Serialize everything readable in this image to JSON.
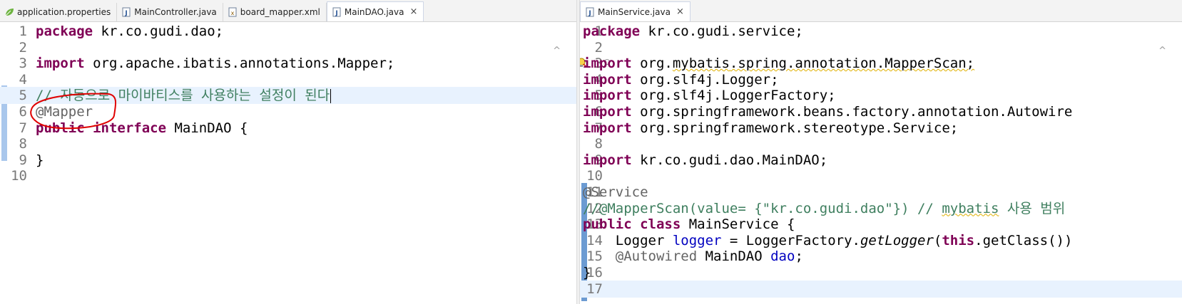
{
  "left_pane": {
    "tabs": [
      {
        "label": "application.properties",
        "icon": "leaf-icon",
        "active": false
      },
      {
        "label": "MainController.java",
        "icon": "java-file-icon",
        "active": false
      },
      {
        "label": "board_mapper.xml",
        "icon": "xml-file-icon",
        "active": false
      },
      {
        "label": "MainDAO.java",
        "icon": "java-file-icon",
        "active": true,
        "close": "×"
      }
    ],
    "lines": [
      {
        "n": "1",
        "code": [
          {
            "t": "package",
            "c": "kw"
          },
          {
            "t": " kr.co.gudi.dao;"
          }
        ]
      },
      {
        "n": "2",
        "code": []
      },
      {
        "n": "3",
        "code": [
          {
            "t": "import",
            "c": "kw"
          },
          {
            "t": " org.apache.ibatis.annotations.Mapper;"
          }
        ]
      },
      {
        "n": "4",
        "code": []
      },
      {
        "n": "5",
        "code": [
          {
            "t": "// 자동으로 마이바티스를 사용하는 설정이 된다",
            "c": "cmt"
          }
        ],
        "current": true,
        "caret": true
      },
      {
        "n": "6",
        "code": [
          {
            "t": "@Mapper",
            "c": "ann"
          }
        ]
      },
      {
        "n": "7",
        "code": [
          {
            "t": "public",
            "c": "kw"
          },
          {
            "t": " "
          },
          {
            "t": "interface",
            "c": "kw"
          },
          {
            "t": " MainDAO {"
          }
        ]
      },
      {
        "n": "8",
        "code": []
      },
      {
        "n": "9",
        "code": [
          {
            "t": "}"
          }
        ]
      },
      {
        "n": "10",
        "code": []
      }
    ]
  },
  "right_pane": {
    "tabs": [
      {
        "label": "MainService.java",
        "icon": "java-file-icon",
        "active": true,
        "close": "×"
      }
    ],
    "lines": [
      {
        "n": "1",
        "code": [
          {
            "t": "package",
            "c": "kw"
          },
          {
            "t": " kr.co.gudi.service;"
          }
        ]
      },
      {
        "n": "2",
        "code": []
      },
      {
        "n": "3",
        "code": [
          {
            "t": "import",
            "c": "kw"
          },
          {
            "t": " org."
          },
          {
            "t": "mybatis",
            "c": "warn"
          },
          {
            "t": ".spring.annotation.MapperScan;",
            "c": "warn"
          }
        ],
        "bulb": true,
        "fold": true
      },
      {
        "n": "4",
        "code": [
          {
            "t": "import",
            "c": "kw"
          },
          {
            "t": " org.slf4j.Logger;"
          }
        ]
      },
      {
        "n": "5",
        "code": [
          {
            "t": "import",
            "c": "kw"
          },
          {
            "t": " org.slf4j.LoggerFactory;"
          }
        ]
      },
      {
        "n": "6",
        "code": [
          {
            "t": "import",
            "c": "kw"
          },
          {
            "t": " org.springframework.beans.factory.annotation.Autowire"
          }
        ]
      },
      {
        "n": "7",
        "code": [
          {
            "t": "import",
            "c": "kw"
          },
          {
            "t": " org.springframework.stereotype.Service;"
          }
        ]
      },
      {
        "n": "8",
        "code": []
      },
      {
        "n": "9",
        "code": [
          {
            "t": "import",
            "c": "kw"
          },
          {
            "t": " kr.co.gudi.dao.MainDAO;"
          }
        ]
      },
      {
        "n": "10",
        "code": []
      },
      {
        "n": "11",
        "code": [
          {
            "t": "@Service",
            "c": "ann"
          }
        ]
      },
      {
        "n": "12",
        "code": [
          {
            "t": "//@MapperScan(value= {\"kr.co.gudi.dao\"}) // ",
            "c": "cmt"
          },
          {
            "t": "mybatis",
            "c": "cmt warn"
          },
          {
            "t": " 사용 범위",
            "c": "cmt"
          }
        ]
      },
      {
        "n": "13",
        "code": [
          {
            "t": "public",
            "c": "kw"
          },
          {
            "t": " "
          },
          {
            "t": "class",
            "c": "kw"
          },
          {
            "t": " MainService {"
          }
        ]
      },
      {
        "n": "14",
        "code": [
          {
            "t": "    Logger "
          },
          {
            "t": "logger",
            "c": "fld"
          },
          {
            "t": " = LoggerFactory."
          },
          {
            "t": "getLogger",
            "c": "ital"
          },
          {
            "t": "("
          },
          {
            "t": "this",
            "c": "kw"
          },
          {
            "t": ".getClass())"
          }
        ]
      },
      {
        "n": "15",
        "code": [
          {
            "t": "    "
          },
          {
            "t": "@Autowired",
            "c": "ann"
          },
          {
            "t": " MainDAO "
          },
          {
            "t": "dao",
            "c": "fld"
          },
          {
            "t": ";"
          }
        ]
      },
      {
        "n": "16",
        "code": [
          {
            "t": "}"
          }
        ]
      },
      {
        "n": "17",
        "code": [],
        "current": true
      }
    ]
  },
  "scroll_up_glyph": "^",
  "annotation_color": "#e00000"
}
